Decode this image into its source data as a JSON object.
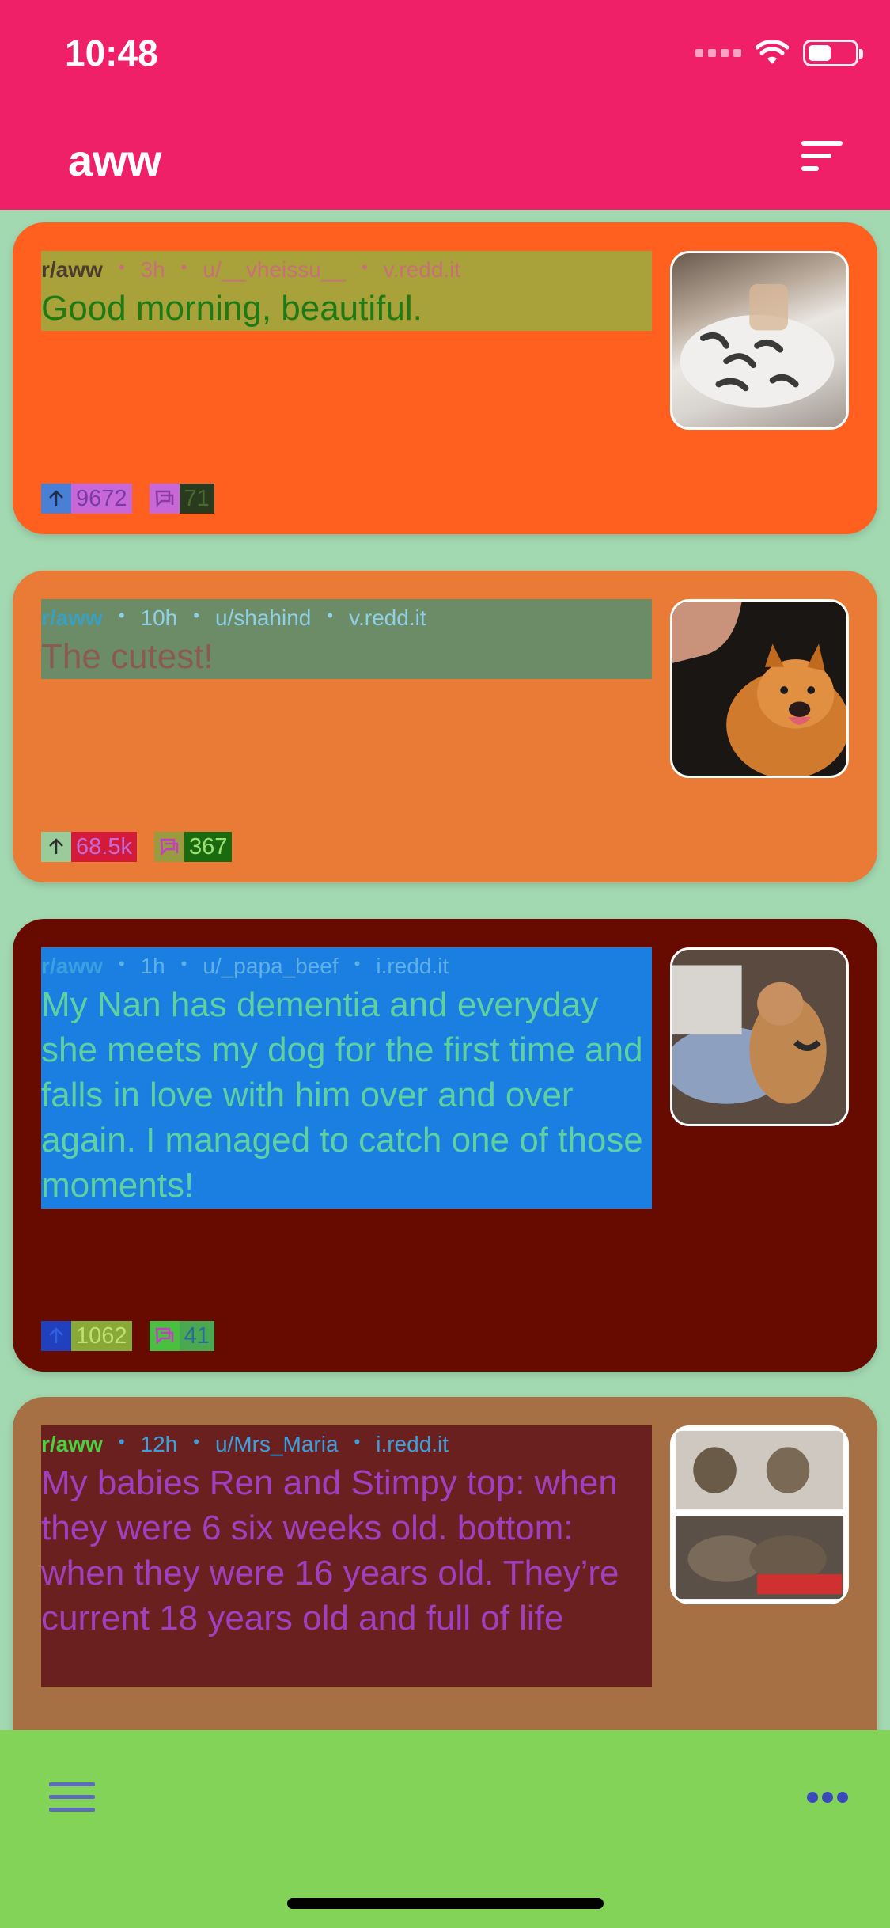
{
  "status": {
    "time": "10:48"
  },
  "header": {
    "title": "aww"
  },
  "posts": [
    {
      "subreddit": "r/aww",
      "age": "3h",
      "author": "u/__vheissu__",
      "domain": "v.redd.it",
      "title": "Good morning, beautiful.",
      "upvotes": "9672",
      "comments": "71",
      "thumb_desc": "cat"
    },
    {
      "subreddit": "r/aww",
      "age": "10h",
      "author": "u/shahind",
      "domain": "v.redd.it",
      "title": "The cutest!",
      "upvotes": "68.5k",
      "comments": "367",
      "thumb_desc": "pomeranian"
    },
    {
      "subreddit": "r/aww",
      "age": "1h",
      "author": "u/_papa_beef",
      "domain": "i.redd.it",
      "title": "My Nan has dementia and everyday she meets my dog for the first time and falls in love with him over and over again. I managed to catch one of those moments!",
      "upvotes": "1062",
      "comments": "41",
      "thumb_desc": "dog"
    },
    {
      "subreddit": "r/aww",
      "age": "12h",
      "author": "u/Mrs_Maria",
      "domain": "i.redd.it",
      "title": "My babies Ren and Stimpy top: when they were 6 six weeks old. bottom: when they were 16 years old. They’re current 18 years old and full of life",
      "thumb_desc": "kittens"
    }
  ],
  "colors": {
    "header": "#ef2067",
    "background": "#a3d9b1",
    "card1": "#ff6020",
    "card2": "#ea7b36",
    "card3": "#670a00",
    "card4": "#a66f44",
    "bottombar": "#82d358"
  },
  "icons": {
    "sort": "sort-icon",
    "upvote": "arrow-up-icon",
    "comments": "comment-icon",
    "menu": "menu-icon",
    "more": "more-icon"
  }
}
